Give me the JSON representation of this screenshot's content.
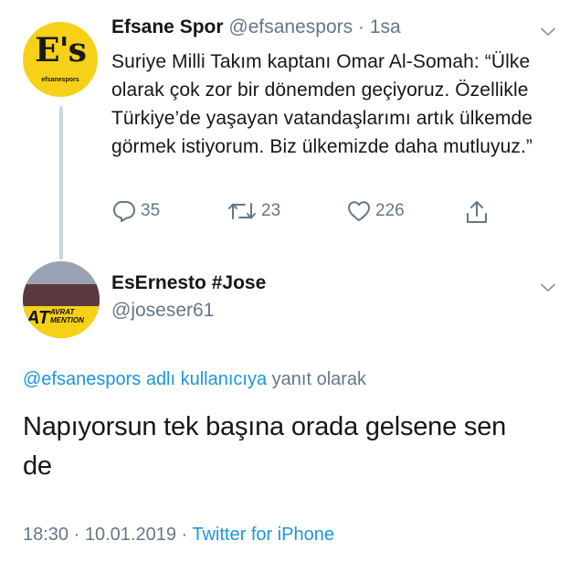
{
  "tweet1": {
    "avatar_text": "E's",
    "avatar_sub": "efsanespors",
    "name": "Efsane Spor",
    "handle": "@efsanespors",
    "separator": "·",
    "time": "1sa",
    "text": "Suriye Milli Takım kaptanı Omar Al-Somah: “Ülke olarak çok zor bir dönemden geçiyoruz. Özellikle Türkiye’de yaşayan vatandaşlarımı artık ülkemde görmek istiyorum. Biz ülkemizde daha mutluyuz.”",
    "replies": "35",
    "retweets": "23",
    "likes": "226",
    "icons": {
      "reply": "reply-icon",
      "retweet": "retweet-icon",
      "like": "heart-icon",
      "share": "share-icon",
      "menu": "chevron-down-icon"
    }
  },
  "tweet2": {
    "avatar_text_big": "AT",
    "avatar_text_small_1": "AVRAT",
    "avatar_text_small_2": "MENTION",
    "name": "EsErnesto #Jose",
    "handle": "@joseser61",
    "reply_mention": "@efsanespors adlı kullanıcıya",
    "reply_suffix": " yanıt olarak",
    "text": "Napıyorsun tek başına orada gelsene sen de",
    "time": "18:30",
    "separator1": " · ",
    "date": "10.01.2019",
    "separator2": " · ",
    "source": "Twitter for iPhone"
  },
  "colors": {
    "text": "#14171a",
    "secondary": "#657786",
    "link": "#1b95e0",
    "thread_line": "#ccd6dd",
    "avatar_yellow": "#f7d117"
  }
}
